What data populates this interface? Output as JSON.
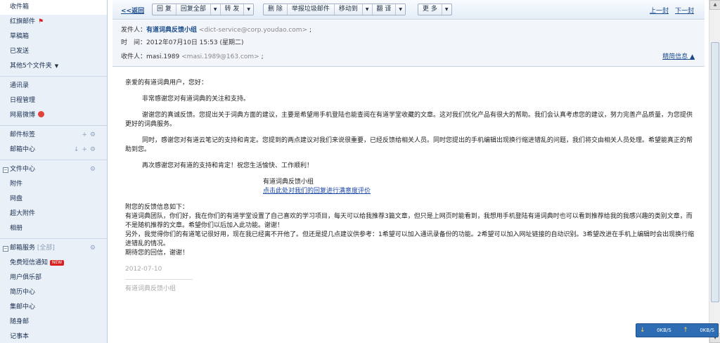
{
  "sidebar": {
    "items": [
      {
        "label": "收件箱"
      },
      {
        "label": "红旗邮件"
      },
      {
        "label": "草稿箱"
      },
      {
        "label": "已发送"
      },
      {
        "label": "其他5个文件夹"
      },
      {
        "label": "通讯录"
      },
      {
        "label": "日程管理"
      },
      {
        "label": "网易微博"
      },
      {
        "label": "邮件标签"
      },
      {
        "label": "邮箱中心"
      },
      {
        "label": "文件中心"
      },
      {
        "label": "附件"
      },
      {
        "label": "网盘"
      },
      {
        "label": "超大附件"
      },
      {
        "label": "相册"
      },
      {
        "label": "邮箱服务"
      },
      {
        "label": "[全部]"
      },
      {
        "label": "免费短信通知"
      },
      {
        "label": "NEW"
      },
      {
        "label": "用户俱乐部"
      },
      {
        "label": "简历中心"
      },
      {
        "label": "集邮中心"
      },
      {
        "label": "随身邮"
      },
      {
        "label": "记事本"
      }
    ]
  },
  "toolbar": {
    "back": "<<返回",
    "reply": "回 复",
    "reply_all": "回复全部",
    "forward": "转 发",
    "delete": "删 除",
    "report_spam": "举报垃圾邮件",
    "move_to": "移动到",
    "translate": "翻 译",
    "more": "更 多",
    "prev": "上一封",
    "next": "下一封"
  },
  "header": {
    "from_label": "发件人：",
    "from_name": "有道词典反馈小组",
    "from_addr": "<dict-service@corp.youdao.com>",
    "time_label": "时　间：",
    "time_value": "2012年07月10日 15:53 (星期二)",
    "to_label": "收件人：",
    "to_name": "masi.1989",
    "to_addr": "<masi.1989@163.com>",
    "brief": "精简信息"
  },
  "body": {
    "greeting": "亲爱的有道词典用户，您好：",
    "p1": "非常感谢您对有道词典的关注和支持。",
    "p2": "谢谢您的真诚反馈。您提出关于词典方面的建议，主要是希望用手机登陆也能查阅在有道学堂收藏的文章。这对我们优化产品有很大的帮助。我们会认真考虑您的建议，努力完善产品质量，为您提供更好的词典服务。",
    "p3": "同时，感谢您对有道云笔记的支持和肯定。您提到的两点建议对我们来说很重要，已经反馈给相关人员。同时您提出的手机编辑出现换行缩进错乱的问题，我们将交由相关人员处理。希望能真正的帮助到您。",
    "p4": "再次感谢您对有道的支持和肯定！祝您生活愉快、工作顺利！",
    "sig_name": "有道词典反馈小组",
    "sig_link": "点击此处对我们的回复进行满意度评价",
    "fb_title": "附您的反馈信息如下：",
    "fb_l1": "有道词典团队，你们好，我在你们的有道学堂设置了自己喜欢的学习项目，每天可以给我推荐3篇文章，但只是上网页时能看到，我想用手机登陆有道词典时也可以看到推荐给我的我感兴趣的类别文章，而不是随机推荐的文章。希望你们以后加入此功能。谢谢！",
    "fb_l2": "另外，我觉得你们的有道笔记很好用，现在我已经离不开他了。但还是提几点建议供参考：1希望可以加入通讯录备份的功能。2希望可以加入网址链接的自动识别。3希望改进在手机上编辑时会出现换行缩进错乱的情况。",
    "fb_l3": "期待您的回信，谢谢！",
    "date": "2012-07-10",
    "footer_sig": "有道词典反馈小组"
  },
  "speed": {
    "down": "0KB/S",
    "up": "0KB/S"
  }
}
